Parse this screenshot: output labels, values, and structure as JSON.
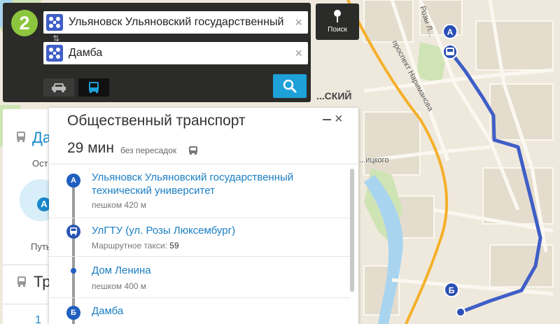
{
  "colors": {
    "accent": "#1da1d8",
    "brand_green": "#8cc63e",
    "route": "#3f5ec7",
    "road_orange": "#f5a623",
    "link": "#1a7ec3"
  },
  "map": {
    "labels": [
      {
        "text": "Розы Л...",
        "name": "street-rozy"
      },
      {
        "text": "проспект Нариманова",
        "name": "street-narimanova"
      },
      {
        "text": "...СКИЙ",
        "name": "district-label"
      },
      {
        "text": "...ицкого",
        "name": "street-itskogo"
      }
    ],
    "marker_a": "А",
    "marker_b": "Б"
  },
  "search": {
    "logo": "2",
    "from_value": "Ульяновск Ульяновский государственный т",
    "to_value": "Дамба",
    "clear_symbol": "×",
    "swap_symbol": "⇅",
    "poisk_label": "Поиск"
  },
  "sidebar": {
    "title": "Да",
    "subtitle": "Ост",
    "circle_letter": "А",
    "path_label": "Путь",
    "section_label": "Тр",
    "number": "1"
  },
  "panel": {
    "title": "Общественный транспорт",
    "minimize_symbol": "−",
    "close_symbol": "×",
    "duration": "29 мин",
    "transfers": "без пересадок",
    "steps": [
      {
        "marker": "А",
        "title": "Ульяновск Ульяновский государственный технический университет",
        "meta": "пешком 420 м"
      },
      {
        "marker": "bus",
        "title": "УлГТУ (ул. Розы Люксембург)",
        "meta_label": "Маршрутное такси:",
        "meta_value": "59"
      },
      {
        "marker": "dot",
        "title": "Дом Ленина",
        "meta": "пешком 400 м"
      },
      {
        "marker": "Б",
        "title": "Дамба",
        "meta": ""
      }
    ]
  }
}
